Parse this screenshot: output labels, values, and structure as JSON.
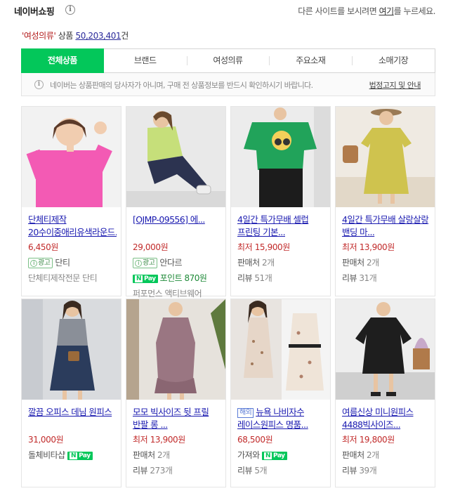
{
  "header": {
    "brand": "네이버쇼핑",
    "notice_before": "다른 사이트를 보시려면 ",
    "notice_link": "여기",
    "notice_after": "를 누르세요."
  },
  "result": {
    "query": "'여성의류'",
    "label": " 상품 ",
    "count": "50,203,401",
    "unit": "건"
  },
  "tabs": [
    "전체상품",
    "브랜드",
    "여성의류",
    "주요소재",
    "소매기장"
  ],
  "disclaimer": {
    "text": "네이버는 상품판매의 당사자가 아니며, 구매 전 상품정보를 반드시 확인하시기 바랍니다.",
    "link": "법정고지 및 안내"
  },
  "badges": {
    "ad": "광고",
    "npay": "Pay",
    "overseas": "해외"
  },
  "products": [
    {
      "title": "단체티제작 20수이중애리유색라운드...",
      "price": "6,450원",
      "ad_seller": "단티",
      "seller": "단체티제작전문 단티"
    },
    {
      "title": "[OJMP-09556] 에...",
      "price": "29,000원",
      "ad_seller": "안다르",
      "point": "포인트 870원",
      "seller": "퍼포먼스 액티브웨어"
    },
    {
      "title": "4일간 특가무배 셀럽 프린팅 기본...",
      "price": "최저 15,900원",
      "sellers_label": "판매처",
      "sellers_count": "2개",
      "review_label": "리뷰",
      "review_count": "51개"
    },
    {
      "title": "4일간 특가무배 살랑살랑 밴딩 마...",
      "price": "최저 13,900원",
      "sellers_label": "판매처",
      "sellers_count": "2개",
      "review_label": "리뷰",
      "review_count": "31개"
    },
    {
      "title": "깔끔 오피스 데님 원피스",
      "price": "31,000원",
      "seller": "돌체비타샵"
    },
    {
      "title": "모모 빅사이즈 뒷 프릴 반팔 롱 ...",
      "price": "최저 13,900원",
      "sellers_label": "판매처",
      "sellers_count": "2개",
      "review_label": "리뷰",
      "review_count": "273개"
    },
    {
      "title": "뉴욕 나비자수 레이스원피스 명품...",
      "price": "68,500원",
      "seller": "가져와",
      "review_label": "리뷰",
      "review_count": "5개"
    },
    {
      "title": "여름신상 미니원피스 4488빅사이즈...",
      "price": "최저 19,800원",
      "sellers_label": "판매처",
      "sellers_count": "2개",
      "review_label": "리뷰",
      "review_count": "39개"
    }
  ],
  "colors": {
    "accent": "#03c75a",
    "price": "#c12a2a",
    "link": "#1a1ab0"
  },
  "icons": [
    "info-icon",
    "npay-icon",
    "ad-badge-icon"
  ]
}
